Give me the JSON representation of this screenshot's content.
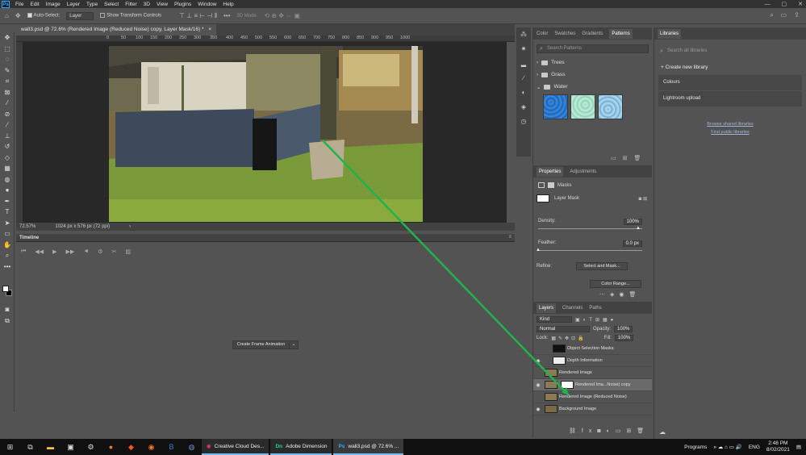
{
  "menubar": {
    "logo": "Ps",
    "items": [
      "File",
      "Edit",
      "Image",
      "Layer",
      "Type",
      "Select",
      "Filter",
      "3D",
      "View",
      "Plugins",
      "Window",
      "Help"
    ],
    "window_controls": [
      "—",
      "▢",
      "✕"
    ]
  },
  "options_bar": {
    "auto_select_label": "Auto-Select:",
    "auto_select_value": "Layer",
    "transform_controls_label": "Show Transform Controls",
    "mode_3d_label": "3D Mode:",
    "more_label": "•••"
  },
  "document_tab": {
    "title": "wall3.psd @ 72.6% (Rendered Image (Reduced Noise) copy, Layer Mask/16) *",
    "close": "×"
  },
  "ruler": {
    "top_marks": [
      "0",
      "50",
      "100",
      "150",
      "200",
      "250",
      "300",
      "350",
      "400",
      "450",
      "500",
      "550",
      "600",
      "650",
      "700",
      "750",
      "800",
      "850",
      "900",
      "950",
      "1000"
    ],
    "left_marks": [
      "0",
      "5",
      "1",
      "1",
      "2",
      "2",
      "3",
      "3",
      "4"
    ]
  },
  "status_bar": {
    "zoom": "72.57%",
    "doc_size": "1024 px x 576 px (72 ppi)",
    "arrow": "›"
  },
  "timeline": {
    "title": "Timeline",
    "create_button": "Create Frame Animation",
    "dropdown_arrow": "⌄"
  },
  "patterns_panel": {
    "tabs": [
      "Color",
      "Swatches",
      "Gradients",
      "Patterns"
    ],
    "active_tab": "Patterns",
    "search_placeholder": "Search Patterns",
    "groups": [
      {
        "name": "Trees",
        "expanded": false
      },
      {
        "name": "Grass",
        "expanded": false
      },
      {
        "name": "Water",
        "expanded": true
      }
    ]
  },
  "properties_panel": {
    "tabs": [
      "Properties",
      "Adjustments"
    ],
    "active_tab": "Properties",
    "masks_label": "Masks",
    "layer_mask_label": "Layer Mask",
    "density_label": "Density:",
    "density_value": "100%",
    "feather_label": "Feather:",
    "feather_value": "0.0 px",
    "refine_label": "Refine:",
    "select_and_mask_button": "Select and Mask...",
    "color_range_button": "Color Range...",
    "density_fraction": 1.0,
    "feather_fraction": 0.0
  },
  "layers_panel": {
    "tabs": [
      "Layers",
      "Channels",
      "Paths"
    ],
    "active_tab": "Layers",
    "filter_kind": "Kind",
    "blend_mode": "Normal",
    "opacity_label": "Opacity:",
    "opacity_value": "100%",
    "lock_label": "Lock:",
    "fill_label": "Fill:",
    "fill_value": "100%",
    "layers": [
      {
        "name": "Object Selection Masks",
        "visible": false,
        "selected": false
      },
      {
        "name": "Depth Information",
        "visible": true,
        "selected": false
      },
      {
        "name": "Rendered Image",
        "visible": false,
        "selected": false
      },
      {
        "name": "Rendered Ima...Noise) copy",
        "visible": true,
        "selected": true
      },
      {
        "name": "Rendered Image (Reduced Noise)",
        "visible": false,
        "selected": false
      },
      {
        "name": "Background Image",
        "visible": true,
        "selected": false
      }
    ]
  },
  "libraries_panel": {
    "tab": "Libraries",
    "search_placeholder": "Search all libraries",
    "create_new_label": "Create new library",
    "items": [
      "Colours",
      "Lightroom upload"
    ],
    "browse_shared_link": "Browse shared libraries",
    "find_public_link": "Find public libraries"
  },
  "taskbar": {
    "apps": [
      {
        "label": "Creative Cloud Des...",
        "icon": "creative-cloud-icon"
      },
      {
        "label": "Adobe Dimension",
        "icon": "dimension-icon",
        "badge": "Dn"
      },
      {
        "label": "wall3.psd @ 72.6% ...",
        "icon": "photoshop-icon",
        "badge": "Ps"
      }
    ],
    "programs_label": "Programs",
    "lang": "ENG",
    "time": "2:48 PM",
    "date": "8/02/2021"
  },
  "colors": {
    "accent": "#31a8ff",
    "annotation_line": "#22b24c",
    "panel_bg": "#535353",
    "dark_bg": "#282828"
  }
}
